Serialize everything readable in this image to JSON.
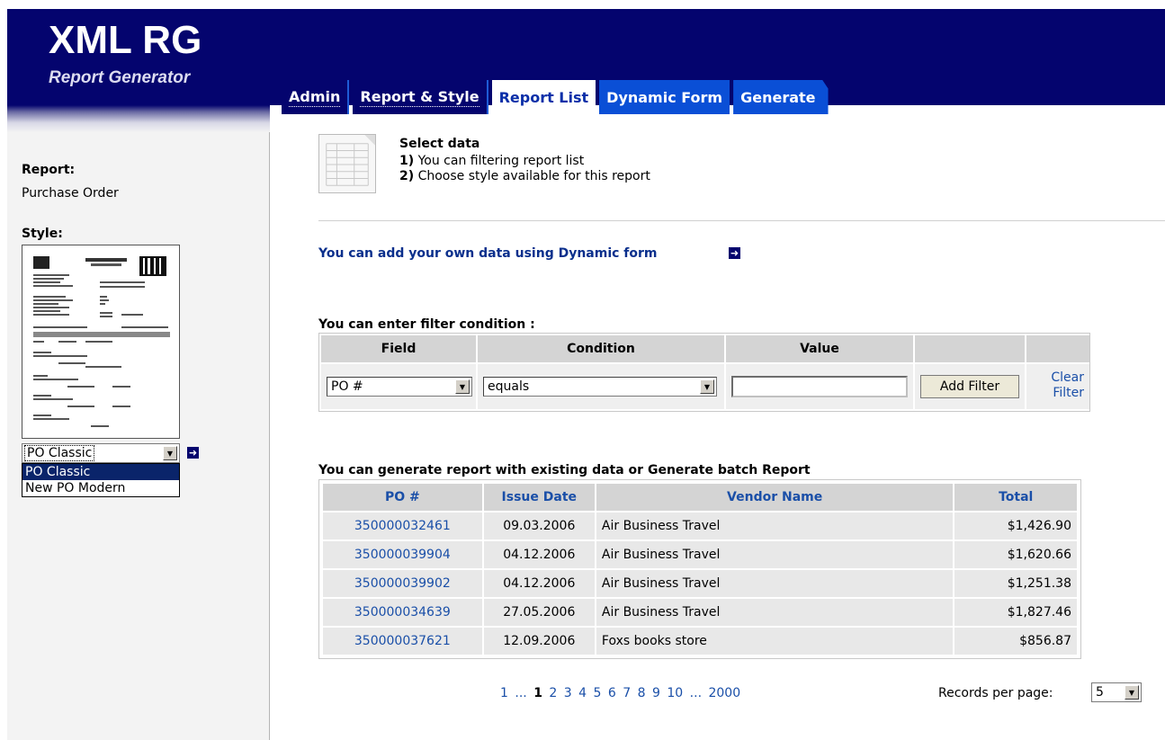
{
  "app": {
    "title": "XML RG",
    "subtitle": "Report Generator"
  },
  "tabs": [
    {
      "label": "Admin"
    },
    {
      "label": "Report & Style"
    },
    {
      "label": "Report List"
    },
    {
      "label": "Dynamic Form"
    },
    {
      "label": "Generate"
    }
  ],
  "sidebar": {
    "report_label": "Report:",
    "report_value": "Purchase Order",
    "style_label": "Style:",
    "style_selected": "PO Classic",
    "style_options": [
      "PO Classic",
      "New PO Modern"
    ]
  },
  "intro": {
    "title": "Select data",
    "step1_num": "1)",
    "step1": " You can filtering report list",
    "step2_num": "2)",
    "step2": " Choose style available for this report"
  },
  "dynamic_link": "You can add your own data using Dynamic form",
  "filter": {
    "title": "You can enter filter condition :",
    "headers": [
      "Field",
      "Condition",
      "Value"
    ],
    "field_value": "PO #",
    "condition_value": "equals",
    "value_input": "",
    "add_button": "Add Filter",
    "clear_line1": "Clear",
    "clear_line2": "Filter"
  },
  "results": {
    "title": "You can generate report with existing data or Generate batch Report",
    "headers": [
      "PO #",
      "Issue Date",
      "Vendor Name",
      "Total"
    ],
    "rows": [
      {
        "po": "350000032461",
        "date": "09.03.2006",
        "vendor": "Air Business Travel",
        "total": "$1,426.90"
      },
      {
        "po": "350000039904",
        "date": "04.12.2006",
        "vendor": "Air Business Travel",
        "total": "$1,620.66"
      },
      {
        "po": "350000039902",
        "date": "04.12.2006",
        "vendor": "Air Business Travel",
        "total": "$1,251.38"
      },
      {
        "po": "350000034639",
        "date": "27.05.2006",
        "vendor": "Air Business Travel",
        "total": "$1,827.46"
      },
      {
        "po": "350000037621",
        "date": "12.09.2006",
        "vendor": "Foxs books store",
        "total": "$856.87"
      }
    ]
  },
  "pager": {
    "first": "1",
    "ellipsis1": "...",
    "current": "1",
    "pages": [
      "2",
      "3",
      "4",
      "5",
      "6",
      "7",
      "8",
      "9",
      "10"
    ],
    "ellipsis2": "...",
    "last": "2000"
  },
  "records_per_page": {
    "label": "Records per page:",
    "value": "5"
  },
  "colors": {
    "header_bg": "#04046e",
    "tab_blue": "#0a4fd6",
    "link_blue": "#1a4fa8",
    "selected_option": "#0a246a"
  },
  "icons": {
    "go": "arrow-right-square-icon",
    "dropdown": "chevron-down-icon",
    "document": "spreadsheet-document-icon"
  }
}
